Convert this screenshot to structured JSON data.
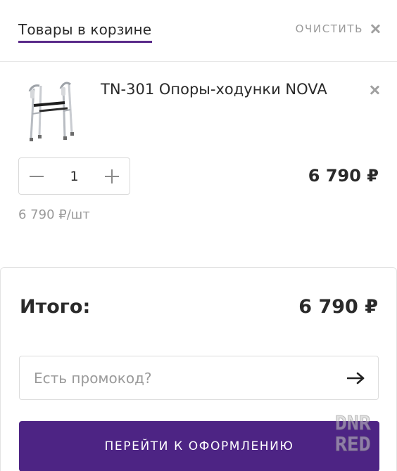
{
  "header": {
    "title": "Товары в корзине",
    "clear_label": "ОЧИСТИТЬ",
    "clear_icon": "close-icon"
  },
  "item": {
    "name": "TN-301 Опоры-ходунки NOVA",
    "image_icon": "walker-image",
    "quantity": "1",
    "price": "6 790 ₽",
    "unit_price": "6 790 ₽/шт"
  },
  "summary": {
    "total_label": "Итого:",
    "total_value": "6 790 ₽",
    "promo_placeholder": "Есть промокод?",
    "checkout_label": "ПЕРЕЙТИ К ОФОРМЛЕНИЮ"
  },
  "watermark": {
    "line1": "DNR",
    "line2": "RED"
  },
  "colors": {
    "accent": "#4d2484",
    "underline": "#5a2a8a",
    "muted": "#9a9a9a",
    "text": "#2a2a2a"
  }
}
